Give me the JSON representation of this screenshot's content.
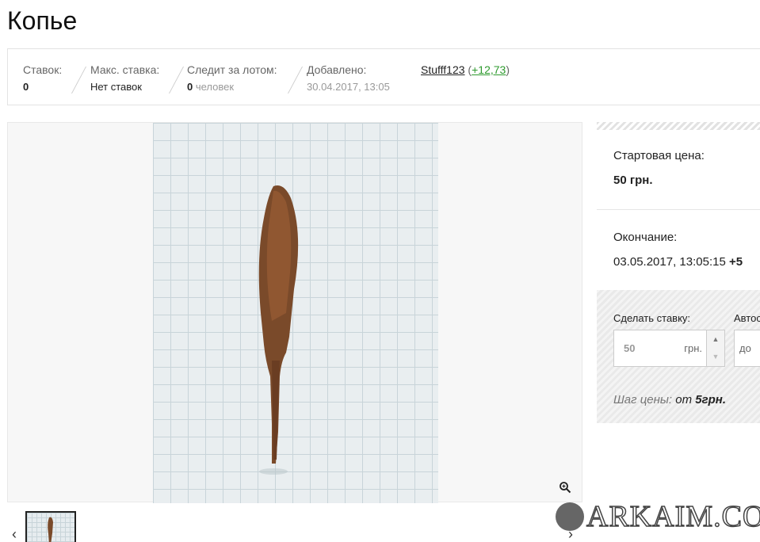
{
  "page": {
    "title": "Копье"
  },
  "stats": {
    "bids_label": "Ставок:",
    "bids_value": "0",
    "max_bid_label": "Макс. ставка:",
    "max_bid_value": "Нет ставок",
    "watchers_label": "Следит за лотом:",
    "watchers_count": "0",
    "watchers_unit": "человек",
    "added_label": "Добавлено:",
    "added_value": "30.04.2017, 13:05",
    "seller_name": "Stufff123",
    "seller_rating": "+12,73"
  },
  "side": {
    "start_price_label": "Стартовая цена:",
    "start_price_value": "50 грн.",
    "end_label": "Окончание:",
    "end_value": "03.05.2017, 13:05:15",
    "end_extra": "+5",
    "bid_label": "Сделать ставку:",
    "bid_value": "50",
    "bid_currency": "грн.",
    "auto_label": "Автоставка:",
    "auto_placeholder": "до",
    "step_label": "Шаг цены:",
    "step_from": "от",
    "step_value": "5грн."
  },
  "watermark": {
    "text": "ARKAIM.CO"
  },
  "colors": {
    "rating": "#2e9a2e",
    "accent_border": "#222222"
  }
}
